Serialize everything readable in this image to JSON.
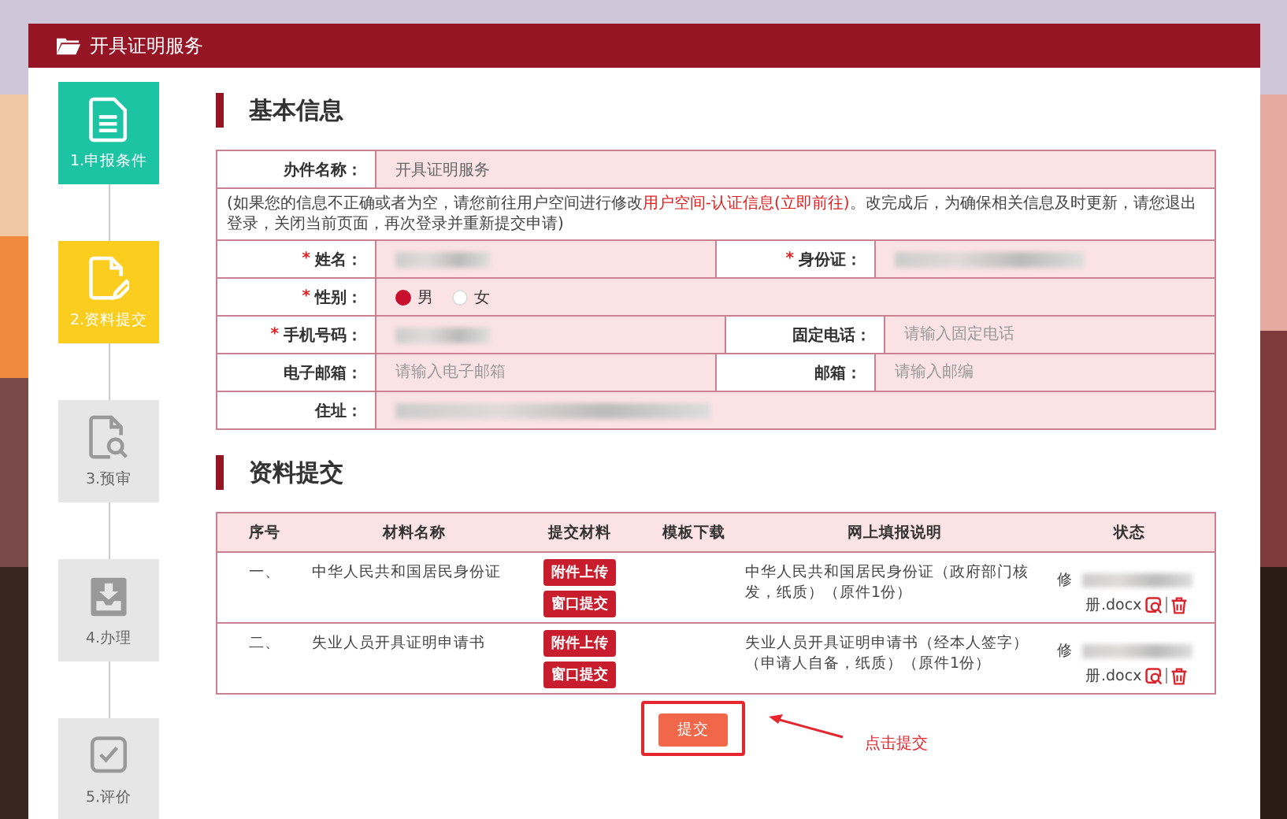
{
  "header": {
    "title": "开具证明服务"
  },
  "steps": [
    {
      "label": "1.申报条件",
      "kind": "document",
      "completed": true,
      "selected": false
    },
    {
      "label": "2.资料提交",
      "kind": "edit",
      "selected": true
    },
    {
      "label": "3.预审",
      "kind": "search",
      "completed": false,
      "selected": false
    },
    {
      "label": "4.办理",
      "kind": "inbox",
      "completed": false,
      "selected": false
    },
    {
      "label": "5.评价",
      "kind": "check",
      "completed": false,
      "selected": false
    }
  ],
  "basic_info": {
    "heading": "基本信息",
    "service": {
      "label": "办件名称：",
      "value": "开具证明服务"
    },
    "notice": {
      "before": "(如果您的信息不正确或者为空，请您前往用户空间进行修改",
      "link": "用户空间-认证信息(立即前往)",
      "after": "。改完成后，为确保相关信息及时更新，请您退出登录，关闭当前页面，再次登录并重新提交申请)"
    },
    "rows": [
      [
        {
          "label": "姓名：",
          "required_mark": "*",
          "kind": "redacted"
        },
        {
          "label": "身份证：",
          "required_mark": "*",
          "kind": "redacted"
        }
      ],
      [
        {
          "label": "性别：",
          "required_mark": "*",
          "kind": "radio",
          "options": [
            {
              "label": "男",
              "selected": true
            },
            {
              "label": "女",
              "selected": false
            }
          ]
        }
      ],
      [
        {
          "label": "手机号码：",
          "required_mark": "*",
          "kind": "redacted"
        },
        {
          "label": "固定电话：",
          "kind": "input",
          "placeholder": "请输入固定电话"
        }
      ],
      [
        {
          "label": "电子邮箱：",
          "kind": "input",
          "placeholder": "请输入电子邮箱"
        },
        {
          "label": "邮箱：",
          "kind": "input",
          "placeholder": "请输入邮编"
        }
      ],
      [
        {
          "label": "住址：",
          "kind": "redacted"
        }
      ]
    ]
  },
  "materials": {
    "heading": "资料提交",
    "columns": [
      "序号",
      "材料名称",
      "提交材料",
      "模板下载",
      "网上填报说明",
      "状态"
    ],
    "rows": [
      {
        "index": "一、",
        "name": "中华人民共和国居民身份证",
        "buttons": [
          "附件上传",
          "窗口提交"
        ],
        "instructions": "中华人民共和国居民身份证（政府部门核发，纸质）（原件1份）",
        "status_prefix": "修",
        "file_suffix": "册.docx"
      },
      {
        "index": "二、",
        "name": "失业人员开具证明申请书",
        "buttons": [
          "附件上传",
          "窗口提交"
        ],
        "instructions": "失业人员开具证明申请书（经本人签字）（申请人自备，纸质）（原件1份）",
        "status_prefix": "修",
        "file_suffix": "册.docx"
      }
    ]
  },
  "submit": {
    "label": "提交",
    "highlighted": true,
    "annotation": "点击提交"
  }
}
